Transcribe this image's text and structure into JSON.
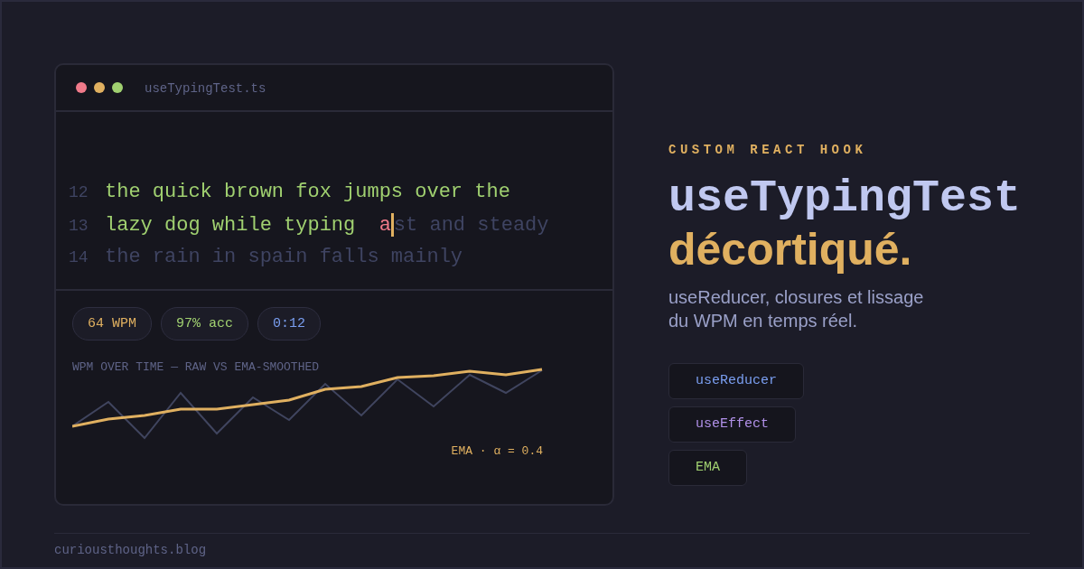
{
  "editor": {
    "filename": "useTypingTest.ts",
    "window_dots": [
      {
        "color": "#f07a8a"
      },
      {
        "color": "#e0b060"
      },
      {
        "color": "#a0d070"
      }
    ],
    "lines": [
      {
        "number": "12",
        "segments": [
          {
            "kind": "typed",
            "text": "the quick brown fox jumps over the"
          }
        ]
      },
      {
        "number": "13",
        "segments": [
          {
            "kind": "typed",
            "text": "lazy dog while typing  "
          },
          {
            "kind": "error",
            "text": "a"
          },
          {
            "kind": "caret"
          },
          {
            "kind": "pending",
            "text": "st and steady"
          }
        ]
      },
      {
        "number": "14",
        "segments": [
          {
            "kind": "pending",
            "text": "the rain in spain falls mainly"
          }
        ]
      }
    ],
    "stats": [
      {
        "text": "64 WPM",
        "color": "#e0b060"
      },
      {
        "text": "97% acc",
        "color": "#a0d070"
      },
      {
        "text": "0:12",
        "color": "#7a9ef0"
      }
    ],
    "chart_title": "WPM OVER TIME — RAW VS EMA-SMOOTHED",
    "chart_note": "EMA · α = 0.4"
  },
  "eyebrow": "CUSTOM REACT HOOK",
  "title": "useTypingTest",
  "title_accent": "décortiqué.",
  "subtitle": [
    "useReducer, closures et lissage",
    "du WPM en temps réel."
  ],
  "tags": [
    {
      "text": "useReducer",
      "color": "#7a9ef0"
    },
    {
      "text": "useEffect",
      "color": "#b090e8"
    },
    {
      "text": "EMA",
      "color": "#a0d070"
    }
  ],
  "footer": "curiousthoughts.blog"
}
